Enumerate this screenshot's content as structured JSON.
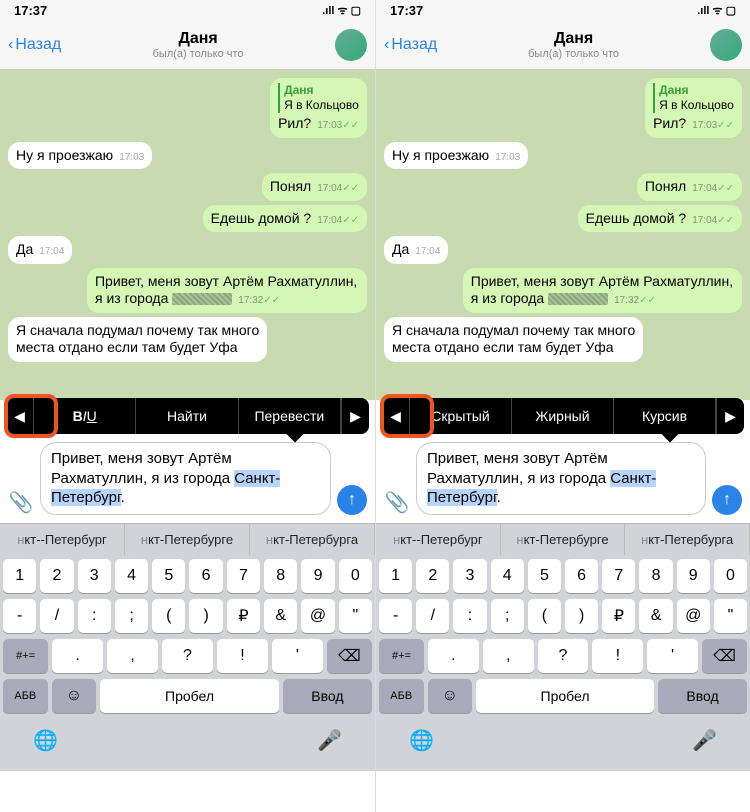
{
  "status": {
    "time": "17:37",
    "signal": "●●●●",
    "wifi": "⌃",
    "batt": "▢"
  },
  "nav": {
    "back": "Назад",
    "title": "Даня",
    "subtitle": "был(а) только что"
  },
  "chat": {
    "m1_name": "Даня",
    "m1_reply": "Я в Кольцово",
    "m1_text": "Рил?",
    "m1_time": "17:03",
    "m2_text": "Ну я проезжаю",
    "m2_time": "17:03",
    "m3_text": "Понял",
    "m3_time": "17:04",
    "m4_text": "Едешь домой ?",
    "m4_time": "17:04",
    "m5_text": "Да",
    "m5_time": "17:04",
    "m6_text": "Привет, меня зовут Артём Рахматуллин, я из города ",
    "m6_time": "17:32",
    "m7_a": "Я сначала подумал почему так много ",
    "m7_b": "места отдано если там будет Уфа"
  },
  "compose": {
    "before": "Привет, меня зовут Артём Рахматуллин, я из города ",
    "sel": "Санкт-Петербург",
    "after": "."
  },
  "menu1": {
    "biu": "BIU",
    "find": "Найти",
    "trans": "Перевести"
  },
  "menu2": {
    "hidden": "Скрытый",
    "bold": "Жирный",
    "italic": "Курсив"
  },
  "predict": {
    "p1a": "н",
    "p1b": "кт--Петербург",
    "p2a": "н",
    "p2b": "кт-Петербурге",
    "p3a": "н",
    "p3b": "кт-Петербурга"
  },
  "kb": {
    "r1": [
      "1",
      "2",
      "3",
      "4",
      "5",
      "6",
      "7",
      "8",
      "9",
      "0"
    ],
    "r2": [
      "-",
      "/",
      ":",
      ";",
      "(",
      ")",
      "₽",
      "&",
      "@",
      "\""
    ],
    "r3_lead": "#+=",
    "r3": [
      ".",
      ",",
      "?",
      "!",
      "'"
    ],
    "r3_del": "⌫",
    "r4_abc": "АБВ",
    "r4_emoji": "☺",
    "r4_space": "Пробел",
    "r4_enter": "Ввод"
  }
}
